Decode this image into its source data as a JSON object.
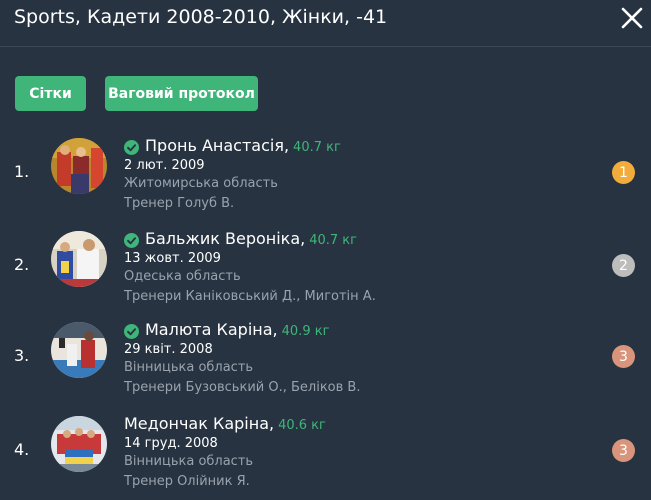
{
  "header": {
    "title": "Sports, Кадети 2008-2010, Жінки, -41",
    "close_icon": "close-icon"
  },
  "toolbar": {
    "grids_label": "Сітки",
    "weigh_in_label": "Ваговий протокол"
  },
  "colors": {
    "background": "#273341",
    "accent": "#3fb57a",
    "gold": "#f2ac3b",
    "silver": "#bdbdbd",
    "bronze": "#d9957c",
    "muted_text": "#9aa3ad"
  },
  "athletes": [
    {
      "rank": "1.",
      "name": "Пронь Анастасія",
      "weight": "40.7 кг",
      "verified": true,
      "dob": "2 лют. 2009",
      "region": "Житомирська область",
      "coach": "Тренер Голуб В.",
      "place": "1",
      "medal": "gold"
    },
    {
      "rank": "2.",
      "name": "Бальжик Вероніка",
      "weight": "40.7 кг",
      "verified": true,
      "dob": "13 жовт. 2009",
      "region": "Одеська область",
      "coach": "Тренери Каніковський Д.,  Миготін А.",
      "place": "2",
      "medal": "silver"
    },
    {
      "rank": "3.",
      "name": "Малюта Каріна",
      "weight": "40.9 кг",
      "verified": true,
      "dob": "29 квіт. 2008",
      "region": "Вінницька область",
      "coach": "Тренери Бузовський О.,  Беліков В.",
      "place": "3",
      "medal": "bronze"
    },
    {
      "rank": "4.",
      "name": "Медончак Каріна",
      "weight": "40.6 кг",
      "verified": false,
      "dob": "14 груд. 2008",
      "region": "Вінницька область",
      "coach": "Тренер Олійник Я.",
      "place": "3",
      "medal": "bronze"
    }
  ]
}
